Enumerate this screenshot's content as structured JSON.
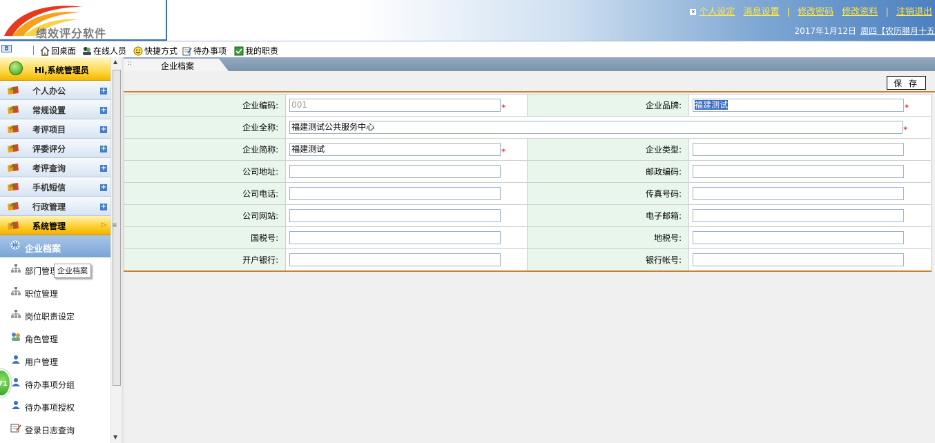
{
  "app": {
    "logo_text": "绩效评分软件"
  },
  "top_links": {
    "personal_settings": "个人设定",
    "message_settings": "消息设置",
    "change_password": "修改密码",
    "edit_profile": "修改资料",
    "logout": "注销退出"
  },
  "date_line": {
    "date": "2017年1月12日",
    "weekday_lunar": "周四【农历腊月十五"
  },
  "toolbar": {
    "home": "回桌面",
    "online": "在线人员",
    "shortcuts": "快捷方式",
    "todo": "待办事项",
    "duties": "我的职责"
  },
  "sidebar": {
    "greeting": "Hi,系统管理员",
    "menu": [
      "个人办公",
      "常规设置",
      "考评项目",
      "评委评分",
      "考评查询",
      "手机短信",
      "行政管理",
      "系统管理"
    ],
    "active_menu": "系统管理",
    "current_sub": "企业档案",
    "sub_items": [
      "部门管理",
      "职位管理",
      "岗位职责设定",
      "角色管理",
      "用户管理",
      "待办事项分组",
      "待办事项授权",
      "登录日志查询"
    ],
    "tooltip": "企业档案",
    "badge": "71"
  },
  "tab": {
    "label": "企业档案"
  },
  "form": {
    "save_label": "保 存",
    "labels": {
      "code": "企业编码:",
      "brand": "企业品牌:",
      "full_name": "企业全称:",
      "short_name": "企业简称:",
      "type": "企业类型:",
      "address": "公司地址:",
      "postal": "邮政编码:",
      "phone": "公司电话:",
      "fax": "传真号码:",
      "website": "公司网站:",
      "email": "电子邮箱:",
      "national_tax": "国税号:",
      "local_tax": "地税号:",
      "bank": "开户银行:",
      "bank_account": "银行帐号:"
    },
    "values": {
      "code": "001",
      "brand": "福建测试",
      "full_name": "福建测试公共服务中心",
      "short_name": "福建测试",
      "type": "",
      "address": "",
      "postal": "",
      "phone": "",
      "fax": "",
      "website": "",
      "email": "",
      "national_tax": "",
      "local_tax": "",
      "bank": "",
      "bank_account": ""
    },
    "required_mark": "*"
  },
  "colors": {
    "accent_orange": "#c8812e",
    "label_bg": "#e9f6ec",
    "header_blue": "#4c80bf",
    "required": "#e00000"
  }
}
